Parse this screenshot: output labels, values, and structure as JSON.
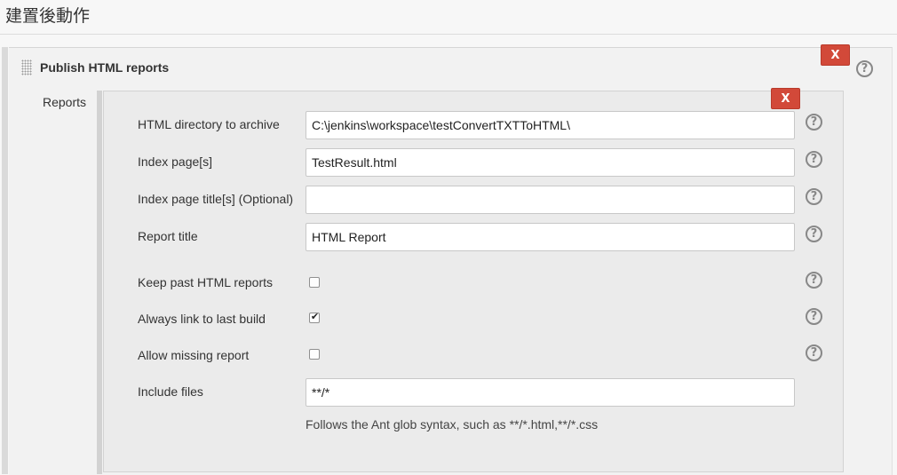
{
  "section": {
    "title": "建置後動作"
  },
  "step": {
    "title": "Publish HTML reports",
    "delete_label": "X",
    "help": "?"
  },
  "reports": {
    "label": "Reports",
    "delete_label": "X",
    "fields": {
      "html_dir": {
        "label": "HTML directory to archive",
        "value": "C:\\jenkins\\workspace\\testConvertTXTToHTML\\"
      },
      "index_pages": {
        "label": "Index page[s]",
        "value": "TestResult.html"
      },
      "index_titles": {
        "label": "Index page title[s] (Optional)",
        "value": ""
      },
      "report_title": {
        "label": "Report title",
        "value": "HTML Report"
      },
      "keep_past": {
        "label": "Keep past HTML reports",
        "checked": false
      },
      "always_link": {
        "label": "Always link to last build",
        "checked": true,
        "check_mark": "✔"
      },
      "allow_missing": {
        "label": "Allow missing report",
        "checked": false
      },
      "include_files": {
        "label": "Include files",
        "value": "**/*",
        "hint": "Follows the Ant glob syntax, such as **/*.html,**/*.css"
      }
    },
    "help": "?"
  }
}
